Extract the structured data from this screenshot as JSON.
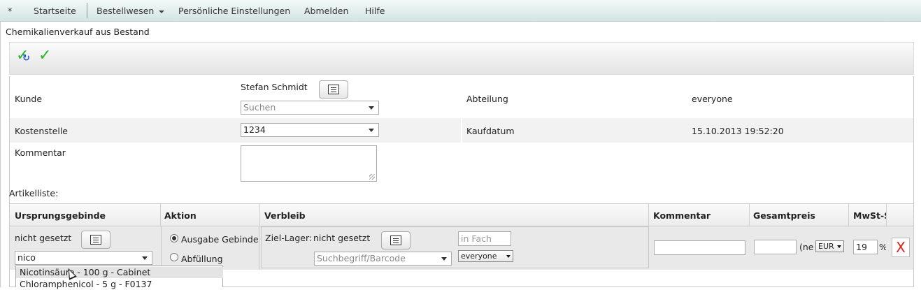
{
  "menu": {
    "items": [
      "*",
      "Startseite",
      "Bestellwesen",
      "Persönliche Einstellungen",
      "Abmelden",
      "Hilfe"
    ]
  },
  "page": {
    "title": "Chemikalienverkauf aus Bestand"
  },
  "toolbar": {
    "icons": [
      "save-apply-icon",
      "check-icon"
    ]
  },
  "form": {
    "kunde_label": "Kunde",
    "kunde_value": "Stefan Schmidt",
    "kunde_search_placeholder": "Suchen",
    "abteilung_label": "Abteilung",
    "abteilung_value": "everyone",
    "kostenstelle_label": "Kostenstelle",
    "kostenstelle_value": "1234",
    "kaufdatum_label": "Kaufdatum",
    "kaufdatum_value": "15.10.2013 19:52:20",
    "kommentar_label": "Kommentar"
  },
  "articles": {
    "section_label": "Artikelliste:",
    "headers": [
      "Ursprungsgebinde",
      "Aktion",
      "Verbleib",
      "Kommentar",
      "Gesamtpreis",
      "MwSt-S"
    ],
    "row": {
      "ursprung_status": "nicht gesetzt",
      "ursprung_input": "nico",
      "aktion_options": [
        "Ausgabe Gebinde",
        "Abfüllung"
      ],
      "aktion_selected": "Ausgabe Gebinde",
      "ziel_lager_label": "Ziel-Lager:",
      "ziel_lager_value": "nicht gesetzt",
      "fach_placeholder": "in Fach",
      "barcode_placeholder": "Suchbegriff/Barcode",
      "group_select": "everyone",
      "price_prefix": "(ne",
      "currency": "EUR",
      "mwst_value": "19",
      "mwst_unit": "%",
      "delete_label": "X"
    }
  },
  "autocomplete": {
    "items": [
      "Nicotinsäure - 100 g - Cabinet",
      "Chloramphenicol - 5 g - F0137"
    ],
    "highlighted": 0
  },
  "colors": {
    "menubar": "#d4e4e4",
    "check_green": "#22bb22",
    "delete_red": "#e02020"
  }
}
